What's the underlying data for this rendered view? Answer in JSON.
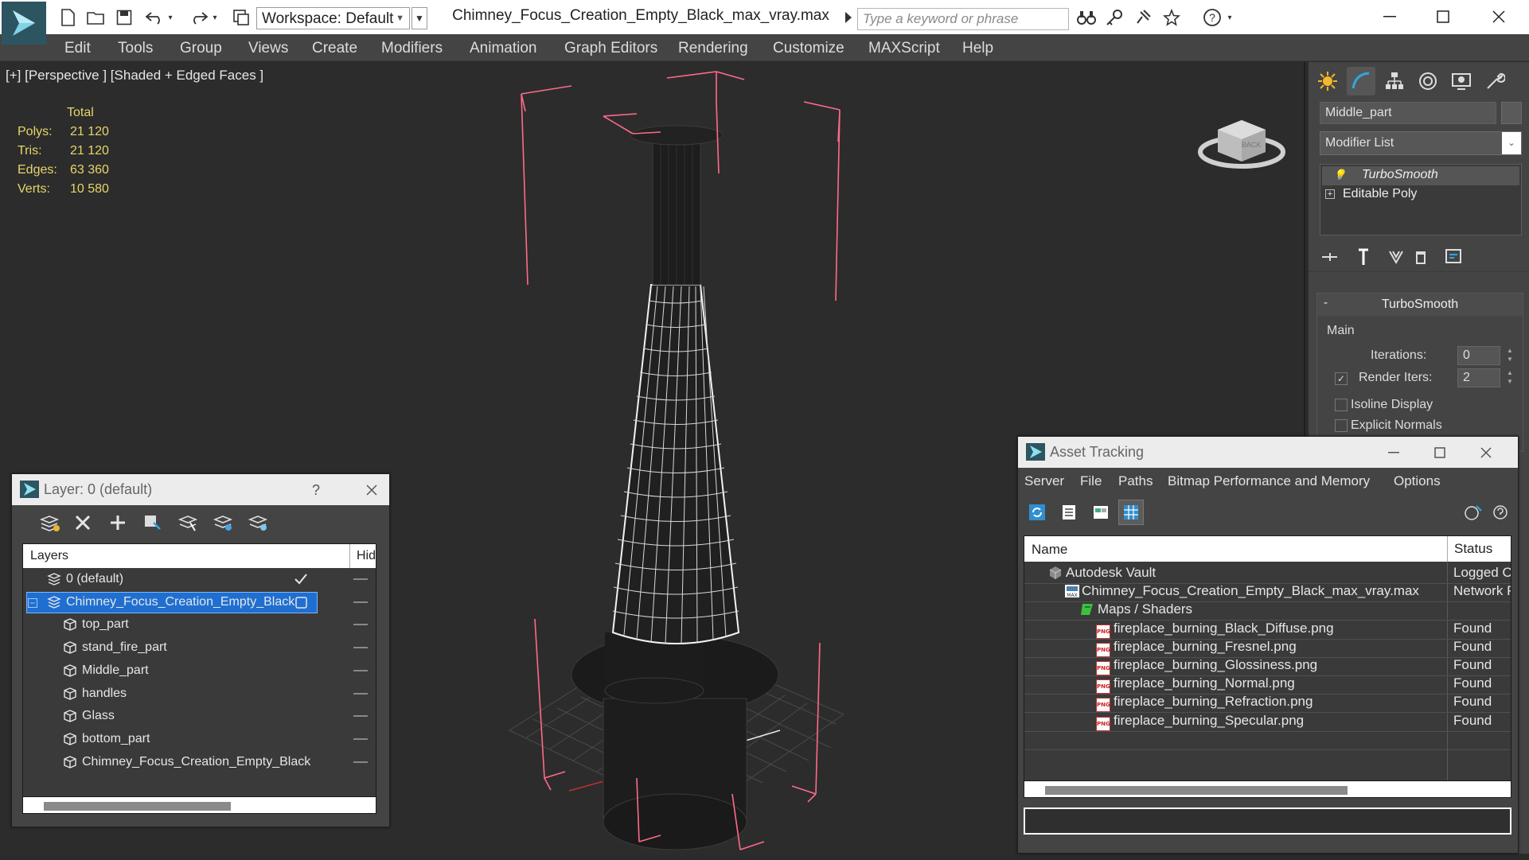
{
  "titlebar": {
    "workspace_label": "Workspace: Default",
    "document_title": "Chimney_Focus_Creation_Empty_Black_max_vray.max",
    "search_placeholder": "Type a keyword or phrase"
  },
  "menu": [
    "Edit",
    "Tools",
    "Group",
    "Views",
    "Create",
    "Modifiers",
    "Animation",
    "Graph Editors",
    "Rendering",
    "Customize",
    "MAXScript",
    "Help"
  ],
  "viewport": {
    "label": "[+] [Perspective ] [Shaded + Edged Faces ]",
    "stats_header": "Total",
    "stats": [
      {
        "label": "Polys:",
        "value": "21 120"
      },
      {
        "label": "Tris:",
        "value": "21 120"
      },
      {
        "label": "Edges:",
        "value": "63 360"
      },
      {
        "label": "Verts:",
        "value": "10 580"
      }
    ],
    "viewcube_face": "BACK",
    "stats_color": "#e7d56a",
    "selection_bracket_color": "#ff6a8a"
  },
  "command_panel": {
    "object_name": "Middle_part",
    "modifier_list_label": "Modifier List",
    "stack": [
      "TurboSmooth",
      "Editable Poly"
    ],
    "rollout_title": "TurboSmooth",
    "group_label": "Main",
    "iterations_label": "Iterations:",
    "iterations_value": "0",
    "render_iters_label": "Render Iters:",
    "render_iters_value": "2",
    "isoline_label": "Isoline Display",
    "explicit_normals_label": "Explicit Normals"
  },
  "layer_window": {
    "title": "Layer: 0 (default)",
    "help": "?",
    "col_layers": "Layers",
    "col_hide": "Hide",
    "rows": [
      {
        "name": "0 (default)",
        "level": 0
      },
      {
        "name": "Chimney_Focus_Creation_Empty_Black",
        "level": 0
      },
      {
        "name": "top_part",
        "level": 1
      },
      {
        "name": "stand_fire_part",
        "level": 1
      },
      {
        "name": "Middle_part",
        "level": 1
      },
      {
        "name": "handles",
        "level": 1
      },
      {
        "name": "Glass",
        "level": 1
      },
      {
        "name": "bottom_part",
        "level": 1
      },
      {
        "name": "Chimney_Focus_Creation_Empty_Black",
        "level": 1
      }
    ],
    "selection_color": "#1f6fd1"
  },
  "asset_window": {
    "title": "Asset Tracking",
    "menu": [
      "Server",
      "File",
      "Paths",
      "Bitmap Performance and Memory",
      "Options"
    ],
    "col_name": "Name",
    "col_status": "Status",
    "rows": [
      {
        "name": "Autodesk Vault",
        "status": "Logged Out",
        "level": 1,
        "icon": "vault-icon"
      },
      {
        "name": "Chimney_Focus_Creation_Empty_Black_max_vray.max",
        "status": "Network Path",
        "level": 2,
        "icon": "max-file-icon"
      },
      {
        "name": "Maps / Shaders",
        "status": "",
        "level": 3,
        "icon": "maps-icon"
      },
      {
        "name": "fireplace_burning_Black_Diffuse.png",
        "status": "Found",
        "level": 4,
        "icon": "png-icon"
      },
      {
        "name": "fireplace_burning_Fresnel.png",
        "status": "Found",
        "level": 4,
        "icon": "png-icon"
      },
      {
        "name": "fireplace_burning_Glossiness.png",
        "status": "Found",
        "level": 4,
        "icon": "png-icon"
      },
      {
        "name": "fireplace_burning_Normal.png",
        "status": "Found",
        "level": 4,
        "icon": "png-icon"
      },
      {
        "name": "fireplace_burning_Refraction.png",
        "status": "Found",
        "level": 4,
        "icon": "png-icon"
      },
      {
        "name": "fireplace_burning_Specular.png",
        "status": "Found",
        "level": 4,
        "icon": "png-icon"
      }
    ]
  }
}
